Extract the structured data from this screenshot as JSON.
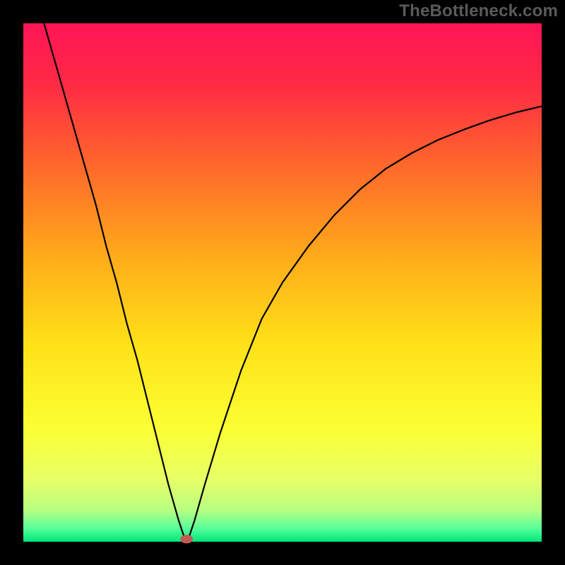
{
  "watermark": "TheBottleneck.com",
  "chart_data": {
    "type": "line",
    "title": "",
    "xlabel": "",
    "ylabel": "",
    "xlim": [
      0,
      100
    ],
    "ylim": [
      0,
      100
    ],
    "gradient_stops": [
      {
        "offset": 0.0,
        "color": "#ff1456"
      },
      {
        "offset": 0.12,
        "color": "#ff2b44"
      },
      {
        "offset": 0.28,
        "color": "#ff6a2a"
      },
      {
        "offset": 0.45,
        "color": "#ffab1a"
      },
      {
        "offset": 0.62,
        "color": "#ffe118"
      },
      {
        "offset": 0.78,
        "color": "#fbff33"
      },
      {
        "offset": 0.88,
        "color": "#e8ff66"
      },
      {
        "offset": 0.94,
        "color": "#b6ff82"
      },
      {
        "offset": 0.975,
        "color": "#55ff99"
      },
      {
        "offset": 1.0,
        "color": "#00e57a"
      }
    ],
    "series": [
      {
        "name": "curve",
        "type": "line",
        "x": [
          4,
          6,
          8,
          10,
          12,
          14,
          16,
          18,
          20,
          22,
          24,
          26,
          28,
          30,
          31,
          31.5,
          32,
          33,
          35,
          38,
          42,
          46,
          50,
          55,
          60,
          65,
          70,
          75,
          80,
          85,
          90,
          95,
          100
        ],
        "y": [
          100,
          93,
          86,
          79,
          72,
          65,
          57,
          50,
          42,
          35,
          27,
          19,
          11,
          4,
          1,
          0.2,
          1,
          4,
          11,
          21,
          33,
          43,
          50,
          57,
          63,
          68,
          72,
          75,
          77.5,
          79.5,
          81.3,
          82.8,
          84
        ]
      }
    ],
    "marker": {
      "x": 31.5,
      "y": 0.5,
      "color": "#c25b56"
    }
  }
}
